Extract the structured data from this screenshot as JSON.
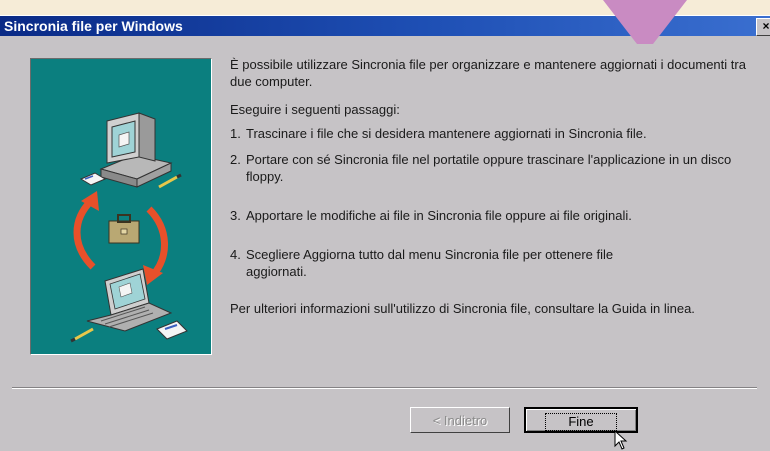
{
  "window": {
    "title": "Sincronia file per Windows",
    "close_label": "×"
  },
  "content": {
    "intro": "È possibile utilizzare Sincronia file per organizzare e mantenere aggiornati i documenti tra due computer.",
    "subhead": "Eseguire i seguenti passaggi:",
    "steps": [
      {
        "num": "1.",
        "text": "Trascinare i file che si desidera mantenere aggiornati in Sincronia file."
      },
      {
        "num": "2.",
        "text": "Portare con sé Sincronia file nel portatile oppure trascinare l'applicazione in un disco floppy."
      },
      {
        "num": "3.",
        "text": "Apportare le modifiche ai file in Sincronia file oppure ai file originali."
      },
      {
        "num": "4.",
        "text": "Scegliere Aggiorna tutto dal menu Sincronia file per ottenere file aggiornati."
      }
    ],
    "footer": "Per ulteriori informazioni sull'utilizzo di Sincronia file, consultare la Guida in linea."
  },
  "buttons": {
    "back": "< Indietro",
    "finish": "Fine"
  },
  "colors": {
    "banner_bg": "#0b7f7f",
    "arrow_red": "#e8502a",
    "marker_pink": "#c98bc2"
  },
  "icons": [
    "desktop-computer-icon",
    "briefcase-icon",
    "laptop-icon",
    "sync-arrows-icon"
  ]
}
